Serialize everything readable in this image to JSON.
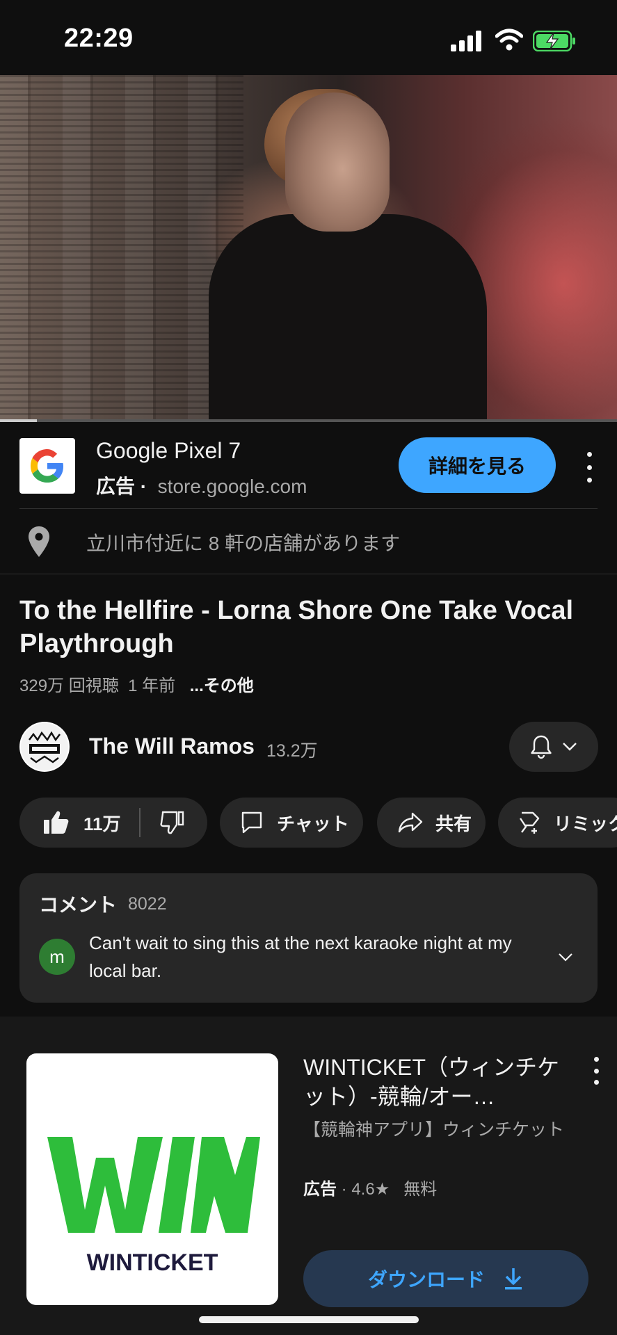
{
  "status": {
    "time": "22:29"
  },
  "ad": {
    "title": "Google Pixel 7",
    "label": "広告 ·",
    "domain": "store.google.com",
    "cta": "詳細を見る",
    "location_text": "立川市付近に 8 軒の店舗があります"
  },
  "video": {
    "title": "To the Hellfire - Lorna Shore One Take Vocal Playthrough",
    "views": "329万 回視聴",
    "age": "1 年前",
    "more": "...その他",
    "progress_fraction": 0.06
  },
  "channel": {
    "name": "The Will Ramos",
    "subscribers": "13.2万"
  },
  "actions": {
    "likes": "11万",
    "chat": "チャット",
    "share": "共有",
    "remix": "リミック"
  },
  "comments": {
    "header": "コメント",
    "count": "8022",
    "avatar_letter": "m",
    "top_comment": "Can't wait to sing this at the next karaoke night at my local bar."
  },
  "app_ad": {
    "title": "WINTICKET（ウィンチケット）-競輪/オー…",
    "subtitle": "【競輪神アプリ】ウィンチケット",
    "label": "広告",
    "rating": "4.6",
    "price": "無料",
    "cta": "ダウンロード",
    "logo_text": "WINTICKET",
    "brand_green": "#2ebd3b",
    "brand_navy": "#1e1a3c"
  },
  "colors": {
    "accent": "#3ea6ff",
    "background": "#0f0f0f",
    "surface": "#272727"
  }
}
